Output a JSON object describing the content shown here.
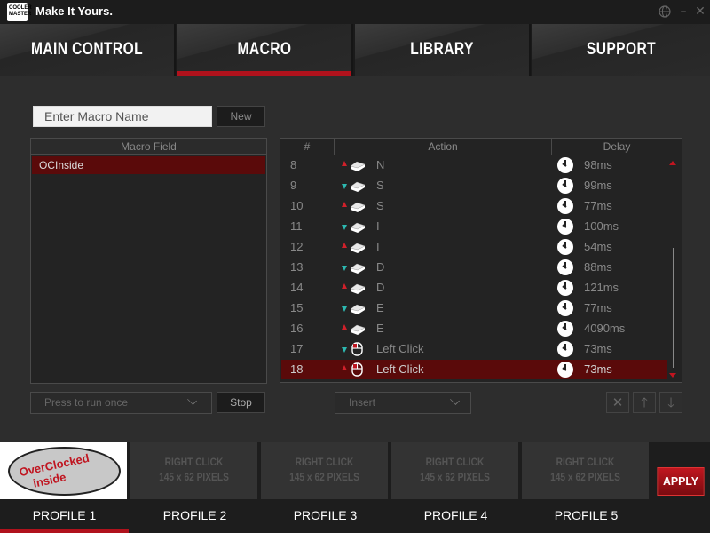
{
  "app": {
    "brand_line": "Make It Yours.",
    "logo_line1": "COOLER",
    "logo_line2": "MASTER"
  },
  "nav": {
    "tabs": [
      {
        "label": "MAIN CONTROL",
        "active": false
      },
      {
        "label": "MACRO",
        "active": true
      },
      {
        "label": "LIBRARY",
        "active": false
      },
      {
        "label": "SUPPORT",
        "active": false
      }
    ]
  },
  "macro": {
    "name_placeholder": "Enter Macro Name",
    "new_label": "New",
    "field_header": "Macro Field",
    "items": [
      "OCInside"
    ],
    "run_mode": "Press to run once",
    "stop_label": "Stop"
  },
  "actions": {
    "headers": {
      "num": "#",
      "action": "Action",
      "delay": "Delay"
    },
    "rows": [
      {
        "num": "8",
        "dir": "up",
        "device": "keyboard",
        "key": "N",
        "delay": "98ms"
      },
      {
        "num": "9",
        "dir": "down",
        "device": "keyboard",
        "key": "S",
        "delay": "99ms"
      },
      {
        "num": "10",
        "dir": "up",
        "device": "keyboard",
        "key": "S",
        "delay": "77ms"
      },
      {
        "num": "11",
        "dir": "down",
        "device": "keyboard",
        "key": "I",
        "delay": "100ms"
      },
      {
        "num": "12",
        "dir": "up",
        "device": "keyboard",
        "key": "I",
        "delay": "54ms"
      },
      {
        "num": "13",
        "dir": "down",
        "device": "keyboard",
        "key": "D",
        "delay": "88ms"
      },
      {
        "num": "14",
        "dir": "up",
        "device": "keyboard",
        "key": "D",
        "delay": "121ms"
      },
      {
        "num": "15",
        "dir": "down",
        "device": "keyboard",
        "key": "E",
        "delay": "77ms"
      },
      {
        "num": "16",
        "dir": "up",
        "device": "keyboard",
        "key": "E",
        "delay": "4090ms"
      },
      {
        "num": "17",
        "dir": "down",
        "device": "mouse",
        "key": "Left Click",
        "delay": "73ms"
      },
      {
        "num": "18",
        "dir": "up",
        "device": "mouse",
        "key": "Left Click",
        "delay": "73ms",
        "selected": true
      }
    ],
    "insert_label": "Insert"
  },
  "profiles": {
    "items": [
      {
        "label": "PROFILE 1",
        "active": true,
        "image_text_1": "OverClocked",
        "image_text_2": "inside"
      },
      {
        "label": "PROFILE 2",
        "placeholder_1": "RIGHT CLICK",
        "placeholder_2": "145 x 62 PIXELS"
      },
      {
        "label": "PROFILE 3",
        "placeholder_1": "RIGHT CLICK",
        "placeholder_2": "145 x 62 PIXELS"
      },
      {
        "label": "PROFILE 4",
        "placeholder_1": "RIGHT CLICK",
        "placeholder_2": "145 x 62 PIXELS"
      },
      {
        "label": "PROFILE 5",
        "placeholder_1": "RIGHT CLICK",
        "placeholder_2": "145 x 62 PIXELS"
      }
    ],
    "apply_label": "APPLY"
  },
  "colors": {
    "accent": "#b0121c",
    "key_down": "#2cb8b0",
    "key_up": "#d0202a"
  },
  "icons": {
    "globe": "globe-icon",
    "minimize": "minimize-icon",
    "close": "close-icon",
    "delete": "delete-icon",
    "move_up": "arrow-up-icon",
    "move_down": "arrow-down-icon"
  }
}
